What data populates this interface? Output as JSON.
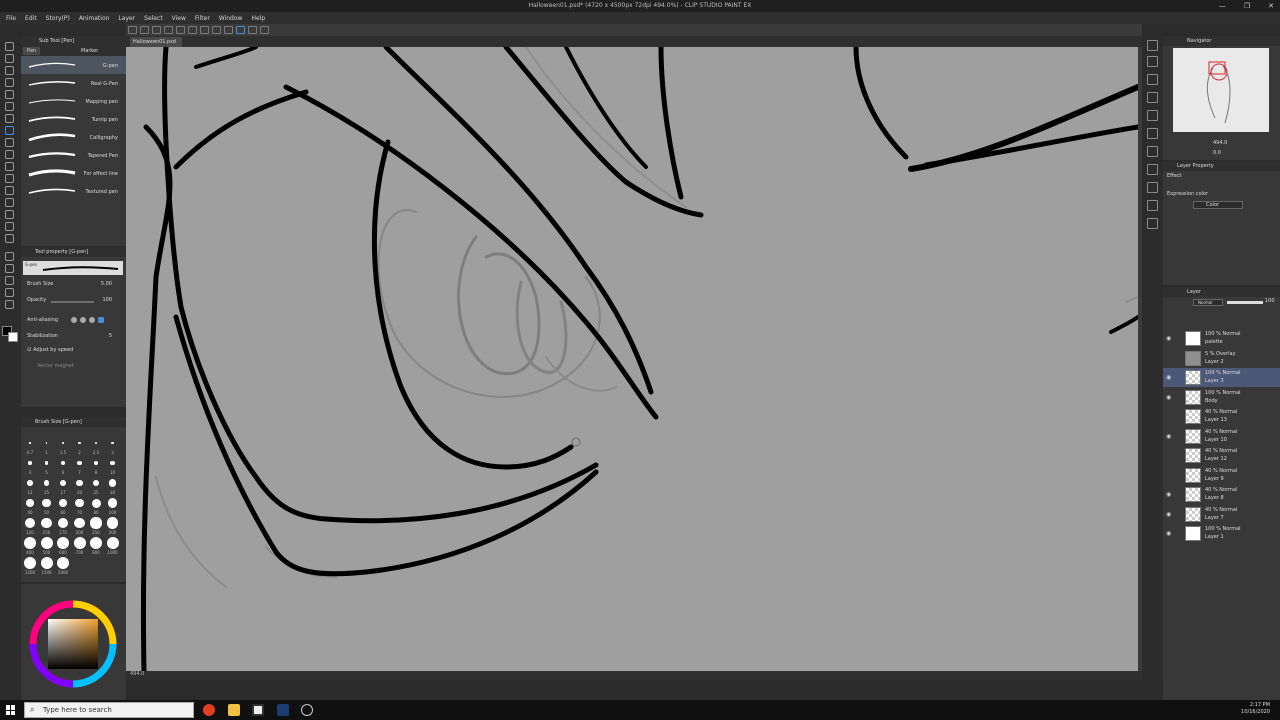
{
  "window": {
    "title": "Halloween01.psd* (4720 x 4500px 72dpi 494.0%) - CLIP STUDIO PAINT EX",
    "controls": [
      "—",
      "❐",
      "✕"
    ]
  },
  "menu": [
    "File",
    "Edit",
    "Story(P)",
    "Animation",
    "Layer",
    "Select",
    "View",
    "Filter",
    "Window",
    "Help"
  ],
  "canvas_tab": "Halloween01.psd",
  "subtool": {
    "header": "Sub Tool [Pen]",
    "tabs": [
      "Pen",
      "Marker"
    ],
    "brushes": [
      {
        "name": "G-pen",
        "active": true
      },
      {
        "name": "Real G-Pen",
        "active": false
      },
      {
        "name": "Mapping pen",
        "active": false
      },
      {
        "name": "Turnip pen",
        "active": false
      },
      {
        "name": "Calligraphy",
        "active": false
      },
      {
        "name": "Tapered Pen",
        "active": false
      },
      {
        "name": "For effect line",
        "active": false
      },
      {
        "name": "Textured pen",
        "active": false
      }
    ]
  },
  "tool_property": {
    "header": "Tool property [G-pen]",
    "brush_name": "G-pen",
    "brush_size_label": "Brush Size",
    "brush_size_value": "5.00",
    "opacity_label": "Opacity",
    "opacity_value": "100",
    "antialiasing_label": "Anti-aliasing",
    "stabilization_label": "Stabilization",
    "stabilization_value": "5",
    "adjust_label": "Adjust by speed",
    "vector_label": "Vector magnet"
  },
  "brush_size_panel": {
    "header": "Brush Size [G-pen]",
    "sizes": [
      "0.7",
      "1",
      "1.5",
      "2",
      "2.5",
      "3",
      "4",
      "5",
      "6",
      "7",
      "8",
      "10",
      "12",
      "15",
      "17",
      "20",
      "25",
      "30",
      "40",
      "50",
      "60",
      "70",
      "80",
      "100",
      "120",
      "150",
      "170",
      "200",
      "250",
      "300",
      "400",
      "500",
      "600",
      "700",
      "800",
      "1000",
      "1200",
      "1500",
      "2000"
    ]
  },
  "navigator": {
    "header": "Navigator",
    "zoom_value": "494.0",
    "rotate_value": "0.0"
  },
  "layer_property": {
    "header": "Layer Property",
    "effect_label": "Effect",
    "expression_label": "Expression color",
    "expression_value": "Color"
  },
  "layer_panel": {
    "header": "Layer",
    "blend_mode": "Normal",
    "opacity": "100",
    "layers": [
      {
        "blend": "100 % Normal",
        "name": "palette",
        "thumb": "white",
        "visible": true,
        "active": false
      },
      {
        "blend": "5 % Overlay",
        "name": "Layer 2",
        "thumb": "gray",
        "visible": false,
        "active": false
      },
      {
        "blend": "100 % Normal",
        "name": "Layer 3",
        "thumb": "check",
        "visible": true,
        "active": true
      },
      {
        "blend": "100 % Normal",
        "name": "Body",
        "thumb": "check",
        "visible": true,
        "active": false
      },
      {
        "blend": "40 % Normal",
        "name": "Layer 13",
        "thumb": "check",
        "visible": false,
        "active": false
      },
      {
        "blend": "40 % Normal",
        "name": "Layer 10",
        "thumb": "check",
        "visible": true,
        "active": false
      },
      {
        "blend": "40 % Normal",
        "name": "Layer 12",
        "thumb": "check",
        "visible": false,
        "active": false
      },
      {
        "blend": "40 % Normal",
        "name": "Layer 9",
        "thumb": "check",
        "visible": false,
        "active": false
      },
      {
        "blend": "40 % Normal",
        "name": "Layer 8",
        "thumb": "check",
        "visible": true,
        "active": false
      },
      {
        "blend": "40 % Normal",
        "name": "Layer 7",
        "thumb": "check",
        "visible": true,
        "active": false
      },
      {
        "blend": "100 % Normal",
        "name": "Layer 1",
        "thumb": "white",
        "visible": true,
        "active": false
      }
    ]
  },
  "canvas_status": "494.0",
  "taskbar": {
    "search_placeholder": "Type here to search",
    "time": "2:17 PM",
    "date": "10/16/2020"
  },
  "colors": {
    "canvas": "#9f9f9f",
    "stroke": "#000000",
    "sketch": "#7e7e7e",
    "accent": "#4a90d9"
  }
}
